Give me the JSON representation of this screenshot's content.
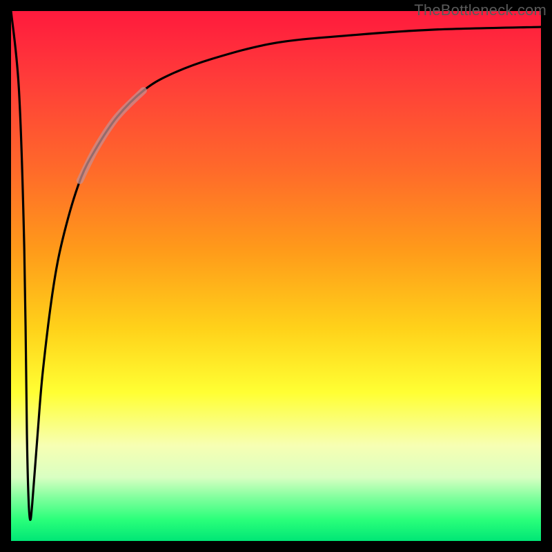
{
  "watermark": "TheBottleneck.com",
  "chart_data": {
    "type": "line",
    "title": "",
    "xlabel": "",
    "ylabel": "",
    "xlim": [
      0,
      100
    ],
    "ylim": [
      0,
      100
    ],
    "grid": false,
    "legend": false,
    "series": [
      {
        "name": "curve",
        "x": [
          0,
          1.5,
          2.5,
          3,
          3.3,
          3.6,
          4,
          5,
          6,
          8,
          10,
          13,
          16,
          20,
          25,
          30,
          38,
          50,
          65,
          80,
          100
        ],
        "values": [
          100,
          85,
          55,
          20,
          8,
          4,
          7,
          20,
          32,
          48,
          58,
          68,
          74,
          80,
          85,
          88,
          91,
          94,
          95.5,
          96.5,
          97
        ]
      }
    ],
    "annotations": [
      {
        "name": "highlight-band",
        "x_range": [
          16,
          22
        ],
        "note": "dim overlay segment on curve"
      }
    ]
  },
  "colors": {
    "curve_stroke": "#000000",
    "highlight_stroke": "#c78f8f",
    "background_black": "#000000"
  }
}
